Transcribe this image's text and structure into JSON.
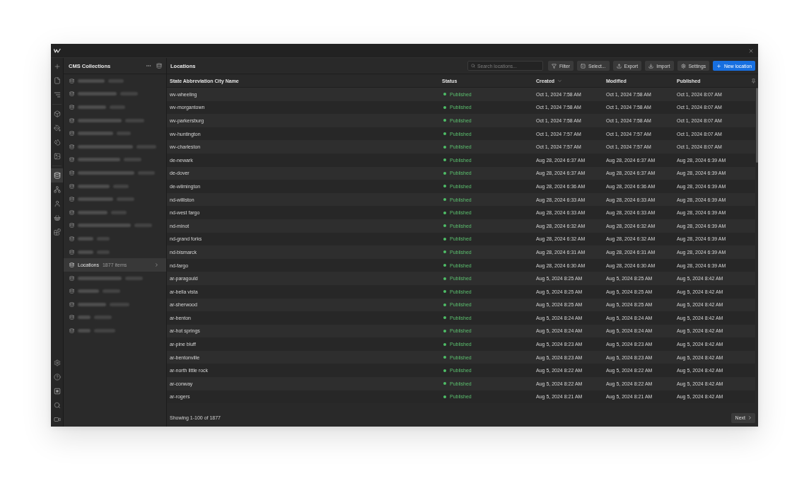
{
  "rail": {
    "top": [
      {
        "kind": "add",
        "selected": false
      },
      {
        "kind": "pages",
        "selected": false
      },
      {
        "kind": "navigator",
        "selected": false
      },
      {
        "kind": "components",
        "selected": false
      },
      {
        "kind": "styles",
        "selected": false
      },
      {
        "kind": "variables",
        "selected": false
      },
      {
        "kind": "assets",
        "selected": false
      },
      {
        "kind": "cms",
        "selected": true
      },
      {
        "kind": "logic",
        "selected": false
      },
      {
        "kind": "users",
        "selected": false
      },
      {
        "kind": "ecommerce",
        "selected": false
      },
      {
        "kind": "apps",
        "selected": false
      }
    ],
    "bottom": [
      {
        "kind": "settings",
        "selected": false
      },
      {
        "kind": "help",
        "selected": false
      },
      {
        "kind": "audit",
        "selected": false
      },
      {
        "kind": "search",
        "selected": false
      },
      {
        "kind": "video",
        "selected": false
      }
    ]
  },
  "sidebar": {
    "title": "CMS Collections",
    "items": [
      {
        "kind": "redacted",
        "selected": false
      },
      {
        "kind": "redacted",
        "selected": false
      },
      {
        "kind": "redacted",
        "selected": false
      },
      {
        "kind": "redacted",
        "selected": false
      },
      {
        "kind": "redacted",
        "selected": false
      },
      {
        "kind": "redacted",
        "selected": false
      },
      {
        "kind": "redacted",
        "selected": false
      },
      {
        "kind": "redacted",
        "selected": false
      },
      {
        "kind": "redacted",
        "selected": false
      },
      {
        "kind": "redacted",
        "selected": false
      },
      {
        "kind": "redacted",
        "selected": false
      },
      {
        "kind": "redacted",
        "selected": false
      },
      {
        "kind": "redacted",
        "selected": false
      },
      {
        "kind": "redacted",
        "selected": false
      },
      {
        "kind": "collection",
        "name": "Locations",
        "count": "1877 items",
        "selected": true
      },
      {
        "kind": "redacted",
        "selected": false
      },
      {
        "kind": "redacted",
        "selected": false
      },
      {
        "kind": "redacted",
        "selected": false
      },
      {
        "kind": "redacted",
        "selected": false
      },
      {
        "kind": "redacted",
        "selected": false
      }
    ]
  },
  "header": {
    "title": "Locations",
    "search": {
      "placeholder": "Search locations..."
    },
    "buttons": [
      {
        "label": "Filter",
        "kind": "filter"
      },
      {
        "label": "Select...",
        "kind": "select"
      },
      {
        "label": "Export",
        "kind": "export"
      },
      {
        "label": "Import",
        "kind": "import"
      },
      {
        "label": "Settings",
        "kind": "settings"
      },
      {
        "label": "New location",
        "kind": "create"
      }
    ]
  },
  "table": {
    "columns": [
      {
        "label": "State Abbreviation City Name",
        "sorted": false
      },
      {
        "label": "Status",
        "sorted": false
      },
      {
        "label": "Created",
        "sorted": true
      },
      {
        "label": "Modified",
        "sorted": false
      },
      {
        "label": "Published",
        "sorted": false
      }
    ],
    "rows": [
      {
        "name": "wv-wheeling",
        "status": "Published",
        "created": "Oct 1, 2024 7:58 AM",
        "modified": "Oct 1, 2024 7:58 AM",
        "published": "Oct 1, 2024 8:07 AM"
      },
      {
        "name": "wv-morgantown",
        "status": "Published",
        "created": "Oct 1, 2024 7:58 AM",
        "modified": "Oct 1, 2024 7:58 AM",
        "published": "Oct 1, 2024 8:07 AM"
      },
      {
        "name": "wv-parkersburg",
        "status": "Published",
        "created": "Oct 1, 2024 7:58 AM",
        "modified": "Oct 1, 2024 7:58 AM",
        "published": "Oct 1, 2024 8:07 AM"
      },
      {
        "name": "wv-huntington",
        "status": "Published",
        "created": "Oct 1, 2024 7:57 AM",
        "modified": "Oct 1, 2024 7:57 AM",
        "published": "Oct 1, 2024 8:07 AM"
      },
      {
        "name": "wv-charleston",
        "status": "Published",
        "created": "Oct 1, 2024 7:57 AM",
        "modified": "Oct 1, 2024 7:57 AM",
        "published": "Oct 1, 2024 8:07 AM"
      },
      {
        "name": "de-newark",
        "status": "Published",
        "created": "Aug 28, 2024 6:37 AM",
        "modified": "Aug 28, 2024 6:37 AM",
        "published": "Aug 28, 2024 6:39 AM"
      },
      {
        "name": "de-dover",
        "status": "Published",
        "created": "Aug 28, 2024 6:37 AM",
        "modified": "Aug 28, 2024 6:37 AM",
        "published": "Aug 28, 2024 6:39 AM"
      },
      {
        "name": "de-wilmington",
        "status": "Published",
        "created": "Aug 28, 2024 6:36 AM",
        "modified": "Aug 28, 2024 6:36 AM",
        "published": "Aug 28, 2024 6:39 AM"
      },
      {
        "name": "nd-williston",
        "status": "Published",
        "created": "Aug 28, 2024 6:33 AM",
        "modified": "Aug 28, 2024 6:33 AM",
        "published": "Aug 28, 2024 6:39 AM"
      },
      {
        "name": "nd-west fargo",
        "status": "Published",
        "created": "Aug 28, 2024 6:33 AM",
        "modified": "Aug 28, 2024 6:33 AM",
        "published": "Aug 28, 2024 6:39 AM"
      },
      {
        "name": "nd-minot",
        "status": "Published",
        "created": "Aug 28, 2024 6:32 AM",
        "modified": "Aug 28, 2024 6:32 AM",
        "published": "Aug 28, 2024 6:39 AM"
      },
      {
        "name": "nd-grand forks",
        "status": "Published",
        "created": "Aug 28, 2024 6:32 AM",
        "modified": "Aug 28, 2024 6:32 AM",
        "published": "Aug 28, 2024 6:39 AM"
      },
      {
        "name": "nd-bismarck",
        "status": "Published",
        "created": "Aug 28, 2024 6:31 AM",
        "modified": "Aug 28, 2024 6:31 AM",
        "published": "Aug 28, 2024 6:39 AM"
      },
      {
        "name": "nd-fargo",
        "status": "Published",
        "created": "Aug 28, 2024 6:30 AM",
        "modified": "Aug 28, 2024 6:30 AM",
        "published": "Aug 28, 2024 6:39 AM"
      },
      {
        "name": "ar-paragould",
        "status": "Published",
        "created": "Aug 5, 2024 8:25 AM",
        "modified": "Aug 5, 2024 8:25 AM",
        "published": "Aug 5, 2024 8:42 AM"
      },
      {
        "name": "ar-bella vista",
        "status": "Published",
        "created": "Aug 5, 2024 8:25 AM",
        "modified": "Aug 5, 2024 8:25 AM",
        "published": "Aug 5, 2024 8:42 AM"
      },
      {
        "name": "ar-sherwood",
        "status": "Published",
        "created": "Aug 5, 2024 8:25 AM",
        "modified": "Aug 5, 2024 8:25 AM",
        "published": "Aug 5, 2024 8:42 AM"
      },
      {
        "name": "ar-benton",
        "status": "Published",
        "created": "Aug 5, 2024 8:24 AM",
        "modified": "Aug 5, 2024 8:24 AM",
        "published": "Aug 5, 2024 8:42 AM"
      },
      {
        "name": "ar-hot springs",
        "status": "Published",
        "created": "Aug 5, 2024 8:24 AM",
        "modified": "Aug 5, 2024 8:24 AM",
        "published": "Aug 5, 2024 8:42 AM"
      },
      {
        "name": "ar-pine bluff",
        "status": "Published",
        "created": "Aug 5, 2024 8:23 AM",
        "modified": "Aug 5, 2024 8:23 AM",
        "published": "Aug 5, 2024 8:42 AM"
      },
      {
        "name": "ar-bentonville",
        "status": "Published",
        "created": "Aug 5, 2024 8:23 AM",
        "modified": "Aug 5, 2024 8:23 AM",
        "published": "Aug 5, 2024 8:42 AM"
      },
      {
        "name": "ar-north little rock",
        "status": "Published",
        "created": "Aug 5, 2024 8:22 AM",
        "modified": "Aug 5, 2024 8:22 AM",
        "published": "Aug 5, 2024 8:42 AM"
      },
      {
        "name": "ar-conway",
        "status": "Published",
        "created": "Aug 5, 2024 8:22 AM",
        "modified": "Aug 5, 2024 8:22 AM",
        "published": "Aug 5, 2024 8:42 AM"
      },
      {
        "name": "ar-rogers",
        "status": "Published",
        "created": "Aug 5, 2024 8:21 AM",
        "modified": "Aug 5, 2024 8:21 AM",
        "published": "Aug 5, 2024 8:42 AM"
      }
    ]
  },
  "footer": {
    "summary": "Showing 1-100 of 1877",
    "next": "Next"
  }
}
